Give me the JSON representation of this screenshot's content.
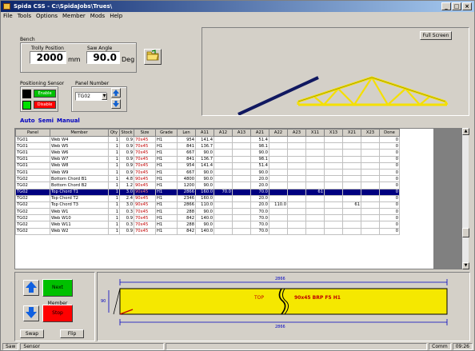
{
  "window": {
    "title": "Spida CSS - C:\\SpidaJobs\\Trues\\"
  },
  "menu": [
    "File",
    "Tools",
    "Options",
    "Member",
    "Mods",
    "Help"
  ],
  "bench": {
    "group_label": "Bench",
    "trolly_label": "Trolly Position",
    "trolly_value": "2000",
    "trolly_unit": "mm",
    "saw_label": "Saw Angle",
    "saw_value": "90.0",
    "saw_unit": "Deg"
  },
  "positioning": {
    "label": "Positioning Sensor",
    "enable": "Enable",
    "disable": "Disable"
  },
  "panel_number": {
    "label": "Panel Number",
    "value": "TG02"
  },
  "preview": {
    "full_screen": "Full Screen"
  },
  "tabs": [
    "Auto",
    "Semi",
    "Manual"
  ],
  "table": {
    "headers": [
      "Panel",
      "Member",
      "Qty",
      "Stock",
      "Size",
      "Grade",
      "Len",
      "A11",
      "A12",
      "A13",
      "A21",
      "A22",
      "A23",
      "X11",
      "X13",
      "X21",
      "X23",
      "Done"
    ],
    "rows": [
      [
        "TG01",
        "Web W4",
        "1",
        "0.9",
        "70x45",
        "H1",
        "954",
        "141.4",
        "",
        "",
        "51.4",
        "",
        "",
        "",
        "",
        "",
        "",
        "0"
      ],
      [
        "TG01",
        "Web W5",
        "1",
        "0.9",
        "70x45",
        "H1",
        "841",
        "136.7",
        "",
        "",
        "98.1",
        "",
        "",
        "",
        "",
        "",
        "",
        "0"
      ],
      [
        "TG01",
        "Web W6",
        "1",
        "0.9",
        "70x45",
        "H1",
        "667",
        "90.0",
        "",
        "",
        "90.0",
        "",
        "",
        "",
        "",
        "",
        "",
        "0"
      ],
      [
        "TG01",
        "Web W7",
        "1",
        "0.9",
        "70x45",
        "H1",
        "841",
        "136.7",
        "",
        "",
        "98.1",
        "",
        "",
        "",
        "",
        "",
        "",
        "0"
      ],
      [
        "TG01",
        "Web W8",
        "1",
        "0.9",
        "70x45",
        "H1",
        "954",
        "141.4",
        "",
        "",
        "51.4",
        "",
        "",
        "",
        "",
        "",
        "",
        "0"
      ],
      [
        "TG01",
        "Web W9",
        "1",
        "0.9",
        "70x45",
        "H1",
        "667",
        "90.0",
        "",
        "",
        "90.0",
        "",
        "",
        "",
        "",
        "",
        "",
        "0"
      ],
      [
        "TG02",
        "Bottom Chord B1",
        "1",
        "4.8",
        "90x45",
        "H1",
        "4800",
        "90.0",
        "",
        "",
        "20.0",
        "",
        "",
        "",
        "",
        "",
        "",
        "0"
      ],
      [
        "TG02",
        "Bottom Chord B2",
        "1",
        "1.2",
        "90x45",
        "H1",
        "1200",
        "90.0",
        "",
        "",
        "20.0",
        "",
        "",
        "",
        "",
        "",
        "",
        "0"
      ],
      [
        "TG02",
        "Top Chord T1",
        "1",
        "3.0",
        "90x45",
        "H1",
        "2866",
        "160.0",
        "70.0",
        "",
        "70.0",
        "",
        "",
        "61",
        "",
        "",
        "",
        "0"
      ],
      [
        "TG02",
        "Top Chord T2",
        "1",
        "2.4",
        "90x45",
        "H1",
        "2346",
        "160.0",
        "",
        "",
        "20.0",
        "",
        "",
        "",
        "",
        "",
        "",
        "0"
      ],
      [
        "TG02",
        "Top Chord T3",
        "1",
        "3.0",
        "90x45",
        "H1",
        "2866",
        "110.0",
        "",
        "",
        "20.0",
        "110.0",
        "",
        "",
        "",
        "61",
        "",
        "0"
      ],
      [
        "TG02",
        "Web W1",
        "1",
        "0.3",
        "70x45",
        "H1",
        "288",
        "90.0",
        "",
        "",
        "70.0",
        "",
        "",
        "",
        "",
        "",
        "",
        "0"
      ],
      [
        "TG02",
        "Web W10",
        "1",
        "0.9",
        "70x45",
        "H1",
        "842",
        "140.0",
        "",
        "",
        "70.0",
        "",
        "",
        "",
        "",
        "",
        "",
        "0"
      ],
      [
        "TG02",
        "Web W11",
        "1",
        "0.3",
        "70x45",
        "H1",
        "288",
        "90.0",
        "",
        "",
        "70.0",
        "",
        "",
        "",
        "",
        "",
        "",
        "0"
      ],
      [
        "TG02",
        "Web W2",
        "1",
        "0.9",
        "70x45",
        "H1",
        "842",
        "140.0",
        "",
        "",
        "70.0",
        "",
        "",
        "",
        "",
        "",
        "",
        "0"
      ]
    ],
    "selected_row": 8
  },
  "bottom": {
    "next_member": "Next Member",
    "stop": "Stop",
    "swap": "Swap",
    "flip": "Flip"
  },
  "member_preview": {
    "top_dim": "2866",
    "bottom_dim": "2866",
    "side_dim": "90",
    "label_top": "TOP",
    "label_size": "90x45 BRP F5 H1"
  },
  "status": {
    "left1": "Saw",
    "left2": "Sensor",
    "right1": "Comm",
    "right2": "09:26"
  },
  "colors": {
    "accent": "#000080",
    "next": "#00c000",
    "stop": "#ff0000",
    "truss": "#f5e000"
  }
}
